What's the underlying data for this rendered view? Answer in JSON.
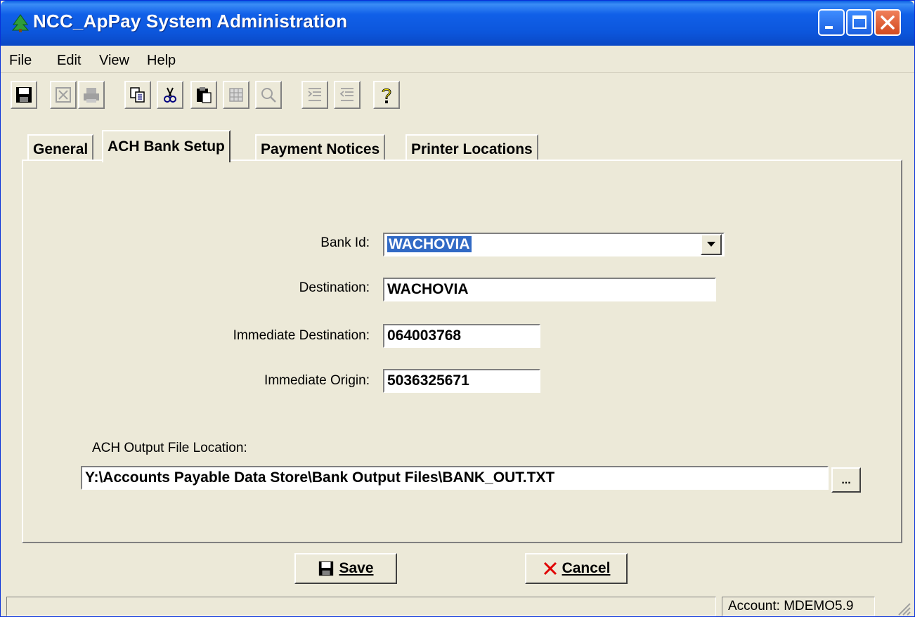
{
  "window": {
    "title": "NCC_ApPay System Administration",
    "icons": {
      "app": "tree-icon",
      "minimize": "minimize-icon",
      "maximize": "maximize-icon",
      "close": "close-icon"
    }
  },
  "menu": [
    "File",
    "Edit",
    "View",
    "Help"
  ],
  "toolbar": {
    "buttons": [
      {
        "icon": "save-icon",
        "enabled": true
      },
      {
        "icon": "excel-icon",
        "enabled": false
      },
      {
        "icon": "print-icon",
        "enabled": false
      },
      {
        "icon": "copy-icon",
        "enabled": true
      },
      {
        "icon": "cut-icon",
        "enabled": true
      },
      {
        "icon": "paste-icon",
        "enabled": true
      },
      {
        "icon": "grid-icon",
        "enabled": false
      },
      {
        "icon": "zoom-icon",
        "enabled": false
      },
      {
        "icon": "indent-icon",
        "enabled": false
      },
      {
        "icon": "outdent-icon",
        "enabled": false
      },
      {
        "icon": "help-icon",
        "enabled": true
      }
    ]
  },
  "tabs": [
    "General",
    "ACH Bank Setup",
    "Payment Notices",
    "Printer Locations"
  ],
  "active_tab": "ACH Bank Setup",
  "form": {
    "bank_id": {
      "label": "Bank Id:",
      "value": "WACHOVIA"
    },
    "destination": {
      "label": "Destination:",
      "value": "WACHOVIA"
    },
    "immediate_destination": {
      "label": "Immediate Destination:",
      "value": "064003768"
    },
    "immediate_origin": {
      "label": "Immediate Origin:",
      "value": "5036325671"
    },
    "output_file": {
      "label": "ACH Output File Location:",
      "value": "Y:\\Accounts Payable Data Store\\Bank Output Files\\BANK_OUT.TXT",
      "browse_label": "..."
    }
  },
  "buttons": {
    "save": {
      "label": "Save",
      "icon": "save-icon"
    },
    "cancel": {
      "label": "Cancel",
      "icon": "cancel-x-icon"
    }
  },
  "status": {
    "account": "Account: MDEMO5.9"
  },
  "colors": {
    "titlebar": "#0c56dc",
    "face": "#ece9d8",
    "selection": "#316ac5",
    "cancel_x": "#e00000"
  }
}
